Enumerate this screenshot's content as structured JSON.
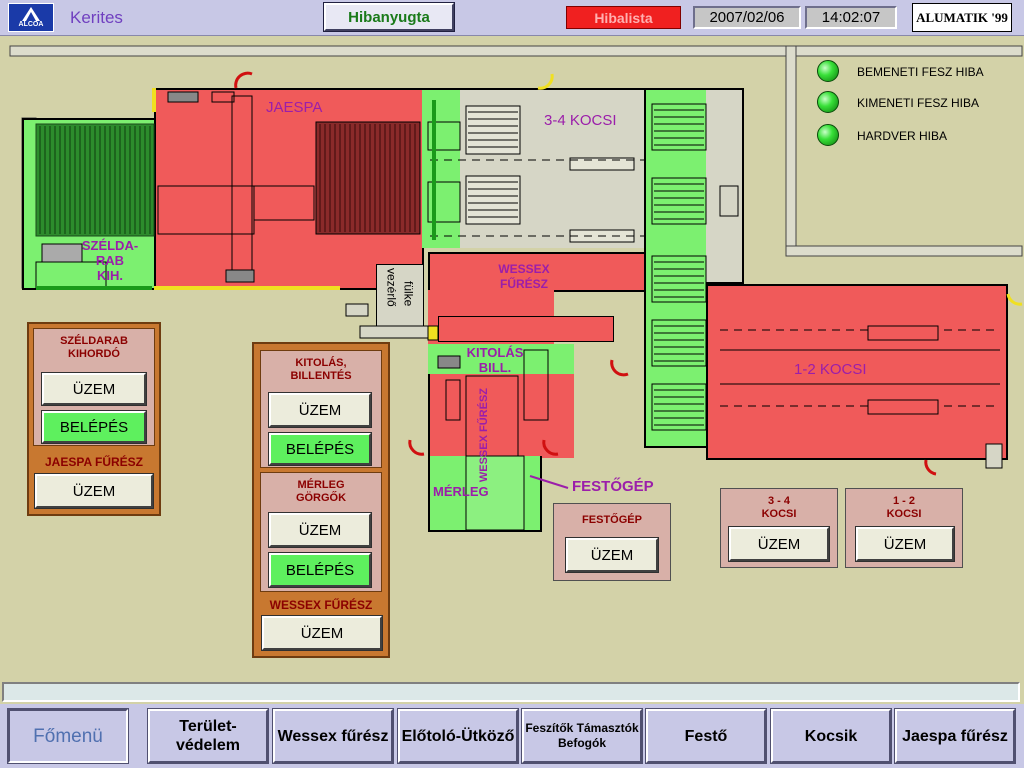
{
  "header": {
    "logo_text": "ALCOA",
    "page_title": "Kerites",
    "ack_button": "Hibanyugta",
    "alarm_list_button": "Hibalista",
    "date": "2007/02/06",
    "time": "14:02:07",
    "brand": "ALUMATIK '99"
  },
  "indicators": [
    {
      "label": "BEMENETI FESZ HIBA",
      "status_color": "#38e038"
    },
    {
      "label": "KIMENETI FESZ HIBA",
      "status_color": "#38e038"
    },
    {
      "label": "HARDVER HIBA",
      "status_color": "#38e038"
    }
  ],
  "map": {
    "jaespa": "JAESPA",
    "kocsi34": "3-4 KOCSI",
    "kocsi12": "1-2 KOCSI",
    "szeldarab_line1": "SZÉLDA-",
    "szeldarab_line2": "RAB",
    "szeldarab_line3": "KIH.",
    "wessex_line1": "WESSEX",
    "wessex_line2": "FŰRÉSZ",
    "vezerlo_line1": "vezérlő",
    "vezerlo_line2": "fülke",
    "kitolas_line1": "KITOLÁS",
    "kitolas_line2": "BILL.",
    "wessex_vertical": "WESSEX FŰRÉSZ",
    "merleg": "MÉRLEG",
    "festogep": "FESTŐGÉP"
  },
  "panels": {
    "szeldarab": {
      "title_line1": "SZÉLDARAB",
      "title_line2": "KIHORDÓ",
      "btn_uzem": "ÜZEM",
      "btn_belepes": "BELÉPÉS",
      "section": "JAESPA FŰRÉSZ",
      "btn_uzem2": "ÜZEM"
    },
    "kitolas": {
      "title_line1": "KITOLÁS,",
      "title_line2": "BILLENTÉS",
      "btn_uzem": "ÜZEM",
      "btn_belepes": "BELÉPÉS",
      "merleg_line1": "MÉRLEG",
      "merleg_line2": "GÖRGŐK",
      "btn_uzem2": "ÜZEM",
      "btn_belepes2": "BELÉPÉS",
      "section": "WESSEX FŰRÉSZ",
      "btn_uzem3": "ÜZEM"
    },
    "festogep": {
      "title": "FESTŐGÉP",
      "btn_uzem": "ÜZEM"
    },
    "kocsi34": {
      "title_line1": "3 - 4",
      "title_line2": "KOCSI",
      "btn_uzem": "ÜZEM"
    },
    "kocsi12": {
      "title_line1": "1 - 2",
      "title_line2": "KOCSI",
      "btn_uzem": "ÜZEM"
    }
  },
  "status_bar": "",
  "nav": [
    {
      "label": "Főmenü"
    },
    {
      "label": "Terület-védelem"
    },
    {
      "label": "Wessex fűrész"
    },
    {
      "label": "Előtoló-Ütköző"
    },
    {
      "label": "Feszítők Támasztók Befogók"
    },
    {
      "label": "Festő"
    },
    {
      "label": "Kocsik"
    },
    {
      "label": "Jaespa fűrész"
    }
  ],
  "colors": {
    "fault": "#f05a5a",
    "ok": "#7cf070",
    "background": "#d3d2a8",
    "label_purple": "#9b1eaa"
  }
}
